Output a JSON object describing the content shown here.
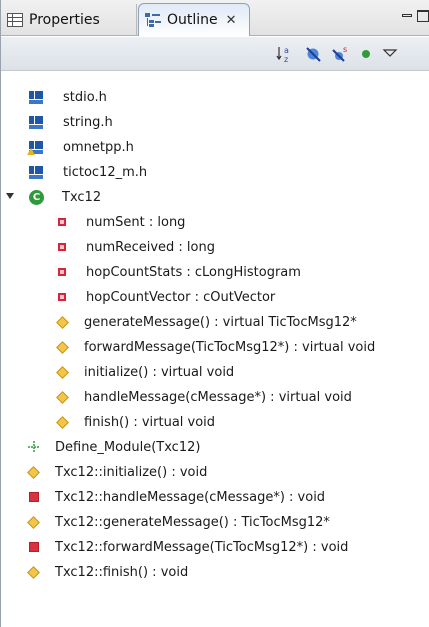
{
  "tabs": [
    {
      "label": "Properties",
      "icon": "properties-icon",
      "active": false
    },
    {
      "label": "Outline",
      "icon": "outline-icon",
      "active": true
    }
  ],
  "tab_close_glyph": "✕",
  "toolbar_icons": [
    "sort-alphabetically-icon",
    "hide-fields-icon",
    "hide-static-icon",
    "hide-non-public-icon",
    "view-menu-icon"
  ],
  "outline_items": [
    {
      "label": "stdio.h",
      "kind": "include"
    },
    {
      "label": "string.h",
      "kind": "include"
    },
    {
      "label": "omnetpp.h",
      "kind": "include-warning"
    },
    {
      "label": "tictoc12_m.h",
      "kind": "include"
    },
    {
      "label": "Txc12",
      "kind": "class",
      "expanded": true
    },
    {
      "label": "numSent : long",
      "kind": "field"
    },
    {
      "label": "numReceived : long",
      "kind": "field"
    },
    {
      "label": "hopCountStats : cLongHistogram",
      "kind": "field"
    },
    {
      "label": "hopCountVector : cOutVector",
      "kind": "field"
    },
    {
      "label": "generateMessage() : virtual TicTocMsg12*",
      "kind": "method"
    },
    {
      "label": "forwardMessage(TicTocMsg12*) : virtual void",
      "kind": "method"
    },
    {
      "label": "initialize() : virtual void",
      "kind": "method"
    },
    {
      "label": "handleMessage(cMessage*) : virtual void",
      "kind": "method"
    },
    {
      "label": "finish() : virtual void",
      "kind": "method"
    },
    {
      "label": "Define_Module(Txc12)",
      "kind": "macro"
    },
    {
      "label": "Txc12::initialize() : void",
      "kind": "function"
    },
    {
      "label": "Txc12::handleMessage(cMessage*) : void",
      "kind": "function-private"
    },
    {
      "label": "Txc12::generateMessage() : TicTocMsg12*",
      "kind": "function"
    },
    {
      "label": "Txc12::forwardMessage(TicTocMsg12*) : void",
      "kind": "function-private"
    },
    {
      "label": "Txc12::finish() : void",
      "kind": "function"
    }
  ],
  "colors": {
    "class_icon": "#2f9b38",
    "field_icon": "#d3283a",
    "method_icon": "#f3c64a",
    "include_icon": "#1f57a8"
  }
}
